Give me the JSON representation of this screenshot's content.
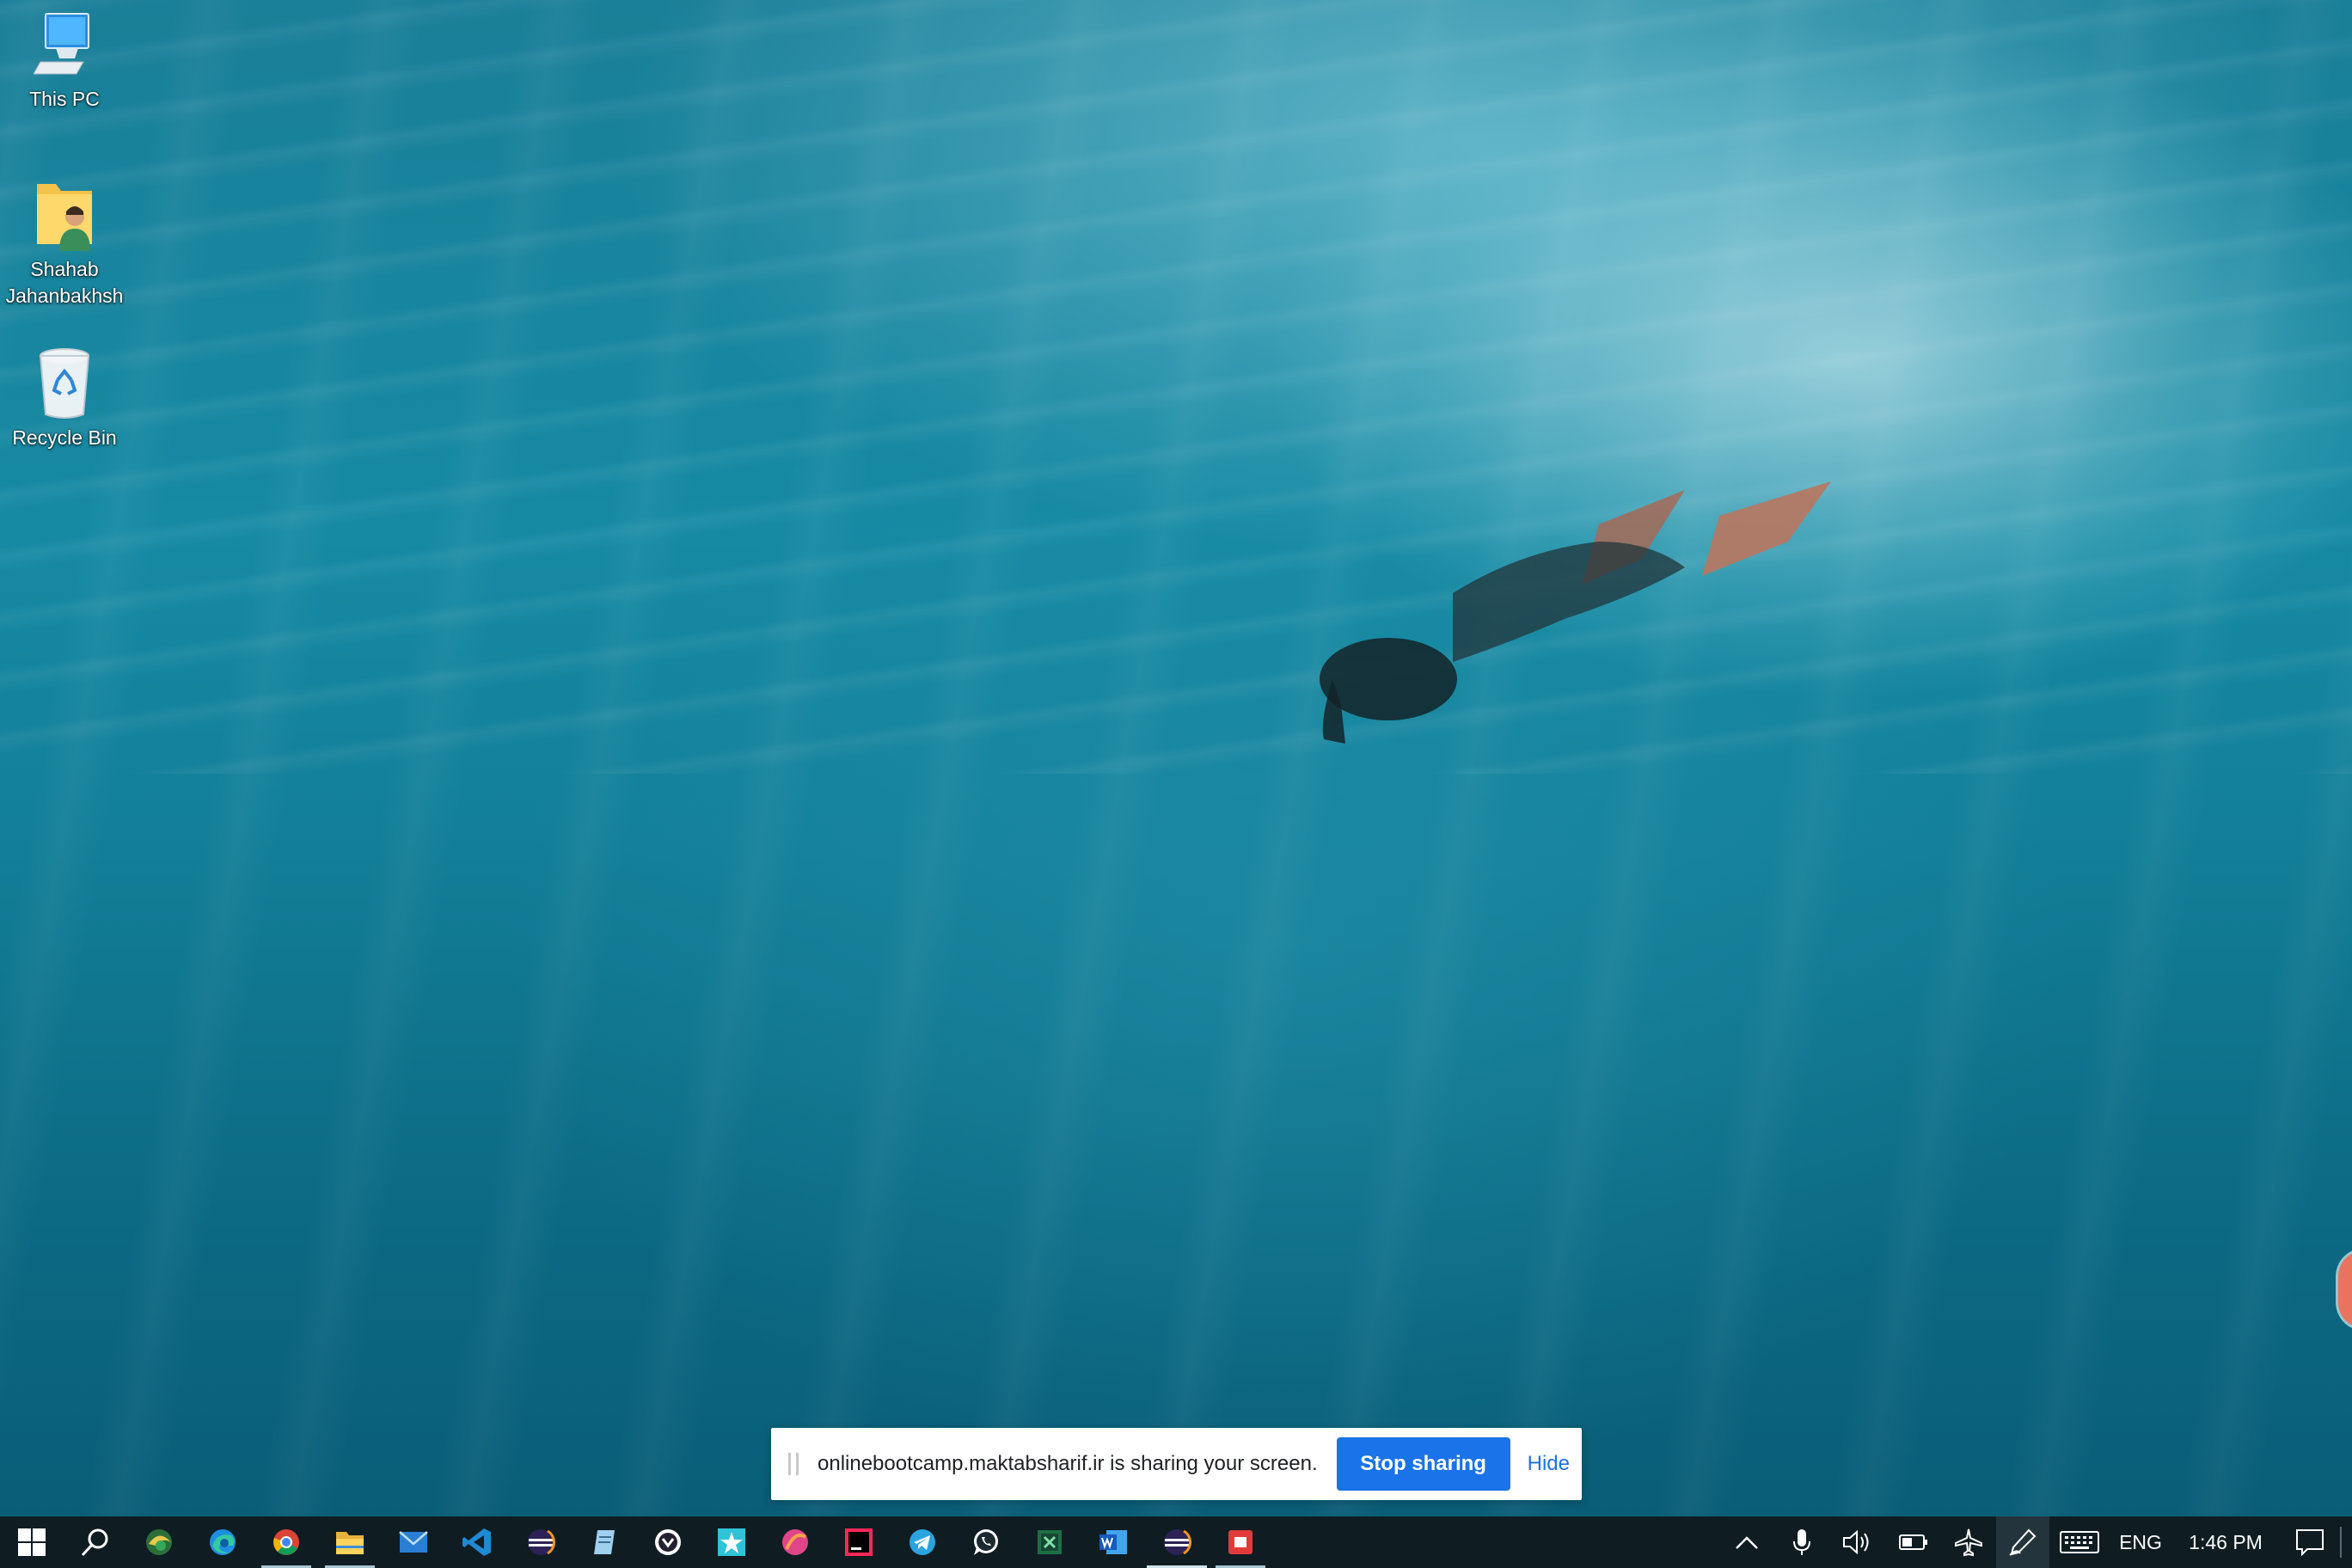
{
  "desktop": {
    "icons": [
      {
        "label": "This PC",
        "icon": "computer-monitor-icon"
      },
      {
        "label": "Shahab Jahanbakhsh",
        "icon": "user-folder-icon"
      },
      {
        "label": "Recycle Bin",
        "icon": "recycle-bin-icon"
      }
    ]
  },
  "share_bar": {
    "message": "onlinebootcamp.maktabsharif.ir is sharing your screen.",
    "stop_label": "Stop sharing",
    "hide_label": "Hide",
    "accent": "#1a73e8"
  },
  "taskbar": {
    "apps": [
      {
        "name": "start",
        "icon": "windows-start-icon"
      },
      {
        "name": "search",
        "icon": "search-icon"
      },
      {
        "name": "edge-canary",
        "icon": "edge-canary-icon"
      },
      {
        "name": "edge",
        "icon": "edge-icon"
      },
      {
        "name": "chrome",
        "icon": "chrome-icon",
        "running": true
      },
      {
        "name": "file-explorer",
        "icon": "folder-icon",
        "running": true
      },
      {
        "name": "mail",
        "icon": "mail-icon"
      },
      {
        "name": "vscode",
        "icon": "vscode-icon"
      },
      {
        "name": "eclipse",
        "icon": "eclipse-icon"
      },
      {
        "name": "notepad",
        "icon": "notepad-icon"
      },
      {
        "name": "qbittorrent",
        "icon": "download-client-icon"
      },
      {
        "name": "app-star",
        "icon": "star-app-icon"
      },
      {
        "name": "app-sphere",
        "icon": "sphere-app-icon"
      },
      {
        "name": "intellij",
        "icon": "intellij-icon"
      },
      {
        "name": "telegram",
        "icon": "telegram-icon"
      },
      {
        "name": "whatsapp",
        "icon": "whatsapp-icon"
      },
      {
        "name": "excel",
        "icon": "excel-icon"
      },
      {
        "name": "word",
        "icon": "word-icon"
      },
      {
        "name": "eclipse-2",
        "icon": "eclipse-icon",
        "running": true,
        "active": true
      },
      {
        "name": "recorder",
        "icon": "screen-recorder-icon",
        "running": true
      }
    ],
    "tray": {
      "language": "ENG",
      "time": "1:46 PM"
    }
  }
}
